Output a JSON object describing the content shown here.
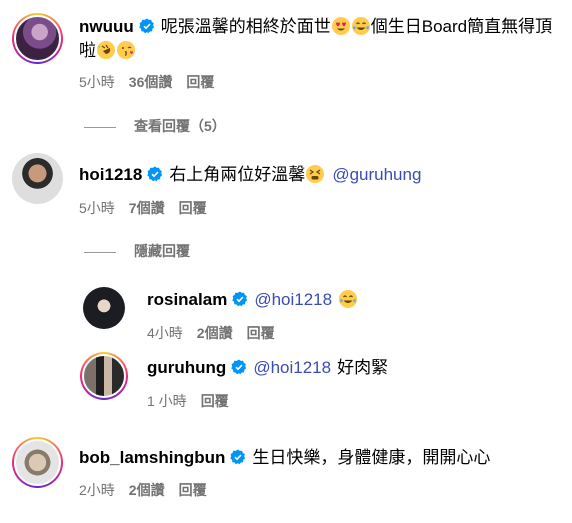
{
  "comments": [
    {
      "username": "nwuuu",
      "text_line1": "呢張溫馨的相終於面世",
      "text_line1b": "個生日Board簡直無得頂",
      "text_line2": "啦",
      "time": "5小時",
      "likes": "36個讚",
      "reply": "回覆",
      "toggle": "查看回覆（5）"
    },
    {
      "username": "hoi1218",
      "text": "右上角兩位好溫馨",
      "mention": "@guruhung",
      "time": "5小時",
      "likes": "7個讚",
      "reply": "回覆",
      "toggle": "隱藏回覆"
    },
    {
      "username": "rosinalam",
      "mention": "@hoi1218",
      "time": "4小時",
      "likes": "2個讚",
      "reply": "回覆"
    },
    {
      "username": "guruhung",
      "mention": "@hoi1218",
      "text": "好肉緊",
      "time": "1 小時",
      "reply": "回覆"
    },
    {
      "username": "bob_lamshingbun",
      "text": "生日快樂，身體健康，開開心心",
      "time": "2小時",
      "likes": "2個讚",
      "reply": "回覆"
    }
  ],
  "colors": {
    "mention": "#3a4cb5",
    "meta": "#737373",
    "verified": "#0095f6"
  },
  "icons": [
    "verified-badge-icon",
    "heart-eyes-emoji",
    "tears-of-joy-emoji",
    "rofl-emoji",
    "kiss-emoji",
    "tired-face-emoji"
  ]
}
